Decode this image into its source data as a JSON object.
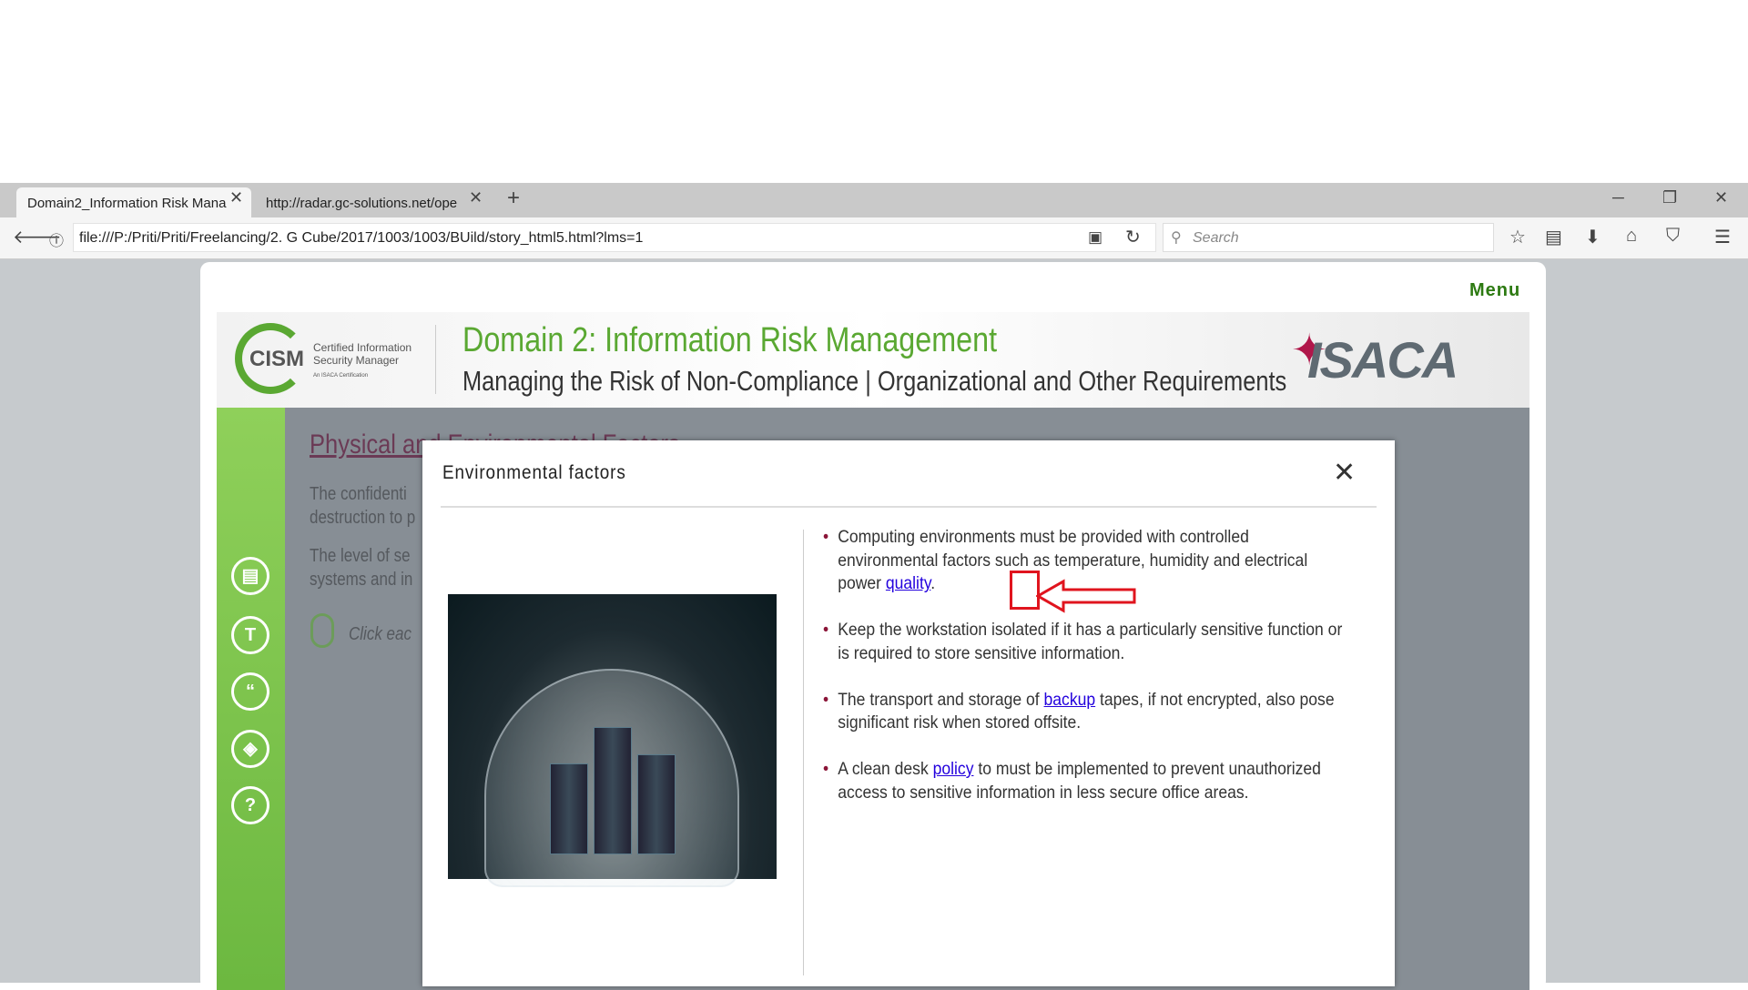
{
  "browser": {
    "tabs": [
      {
        "title": "Domain2_Information Risk Mana"
      },
      {
        "title": "http://radar.gc-solutions.net/ope"
      }
    ],
    "url": "file:///P:/Priti/Priti/Freelancing/2. G Cube/2017/1003/1003/BUild/story_html5.html?lms=1",
    "search_placeholder": "Search"
  },
  "course": {
    "menu_label": "Menu",
    "logo_text": "CISM",
    "logo_sub": "Certified Information Security Manager",
    "logo_tiny": "An ISACA Certification",
    "title": "Domain 2: Information Risk Management",
    "subtitle": "Managing the Risk of Non-Compliance | Organizational and Other Requirements",
    "brand": "ISACA",
    "bg_title": "Physical and Environmental Factors",
    "bg_lines": [
      "The confidenti",
      "destruction to p",
      "The level of se",
      "systems and in"
    ],
    "bg_click": "Click eac",
    "sidebar_icons": [
      "glossary",
      "transcript",
      "quote",
      "resources",
      "help"
    ]
  },
  "modal": {
    "title": "Environmental factors",
    "bullets": [
      {
        "pre": "Computing environments must be provided with controlled environmental factors such as temperature, humidity and electrical power ",
        "link": "quality",
        "post": "."
      },
      {
        "pre": "Keep the workstation isolated if it has a particularly sensitive function or is required to store sensitive information.",
        "link": "",
        "post": ""
      },
      {
        "pre": "The transport and storage of ",
        "link": "backup",
        "post": " tapes, if not encrypted, also pose significant risk when stored offsite."
      },
      {
        "pre": "A clean desk ",
        "link": "policy",
        "post": " to must be implemented to prevent unauthorized access to sensitive information in less secure office areas."
      }
    ]
  },
  "colors": {
    "accent": "#5aa832",
    "annotation": "#e0141e"
  }
}
